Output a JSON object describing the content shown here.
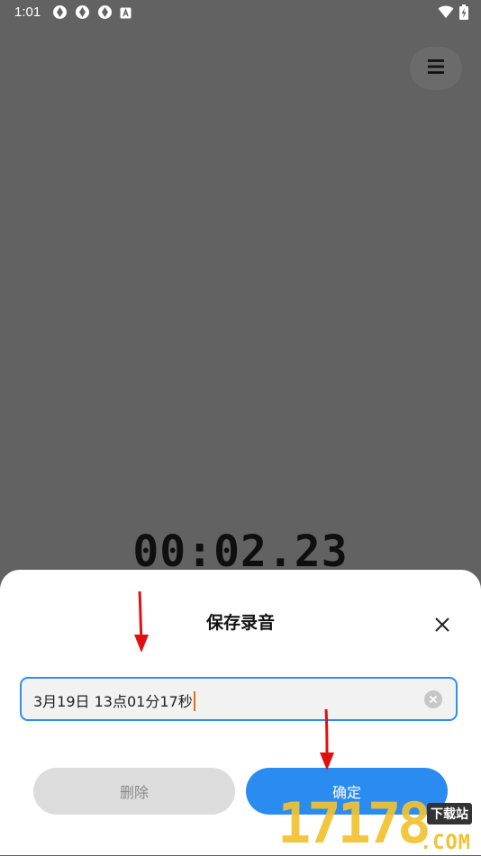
{
  "status_bar": {
    "time": "1:01",
    "notification_icons": [
      "app-notification-icon",
      "app-notification-icon",
      "app-notification-icon",
      "a-square-icon"
    ],
    "system_icons": [
      "wifi-icon",
      "battery-charging-icon"
    ]
  },
  "recorder": {
    "timer": "00:02.23",
    "menu_icon": "hamburger-menu-icon"
  },
  "save_dialog": {
    "title": "保存录音",
    "filename_value": "3月19日 13点01分17秒",
    "delete_label": "删除",
    "confirm_label": "确定"
  },
  "watermark": {
    "number": "17178",
    "site": "下载站",
    "domain": ".COM"
  },
  "colors": {
    "accent": "#2a8cf0",
    "background_dim": "#626262",
    "annotation_arrow": "#e01010",
    "watermark": "#f2c230"
  }
}
